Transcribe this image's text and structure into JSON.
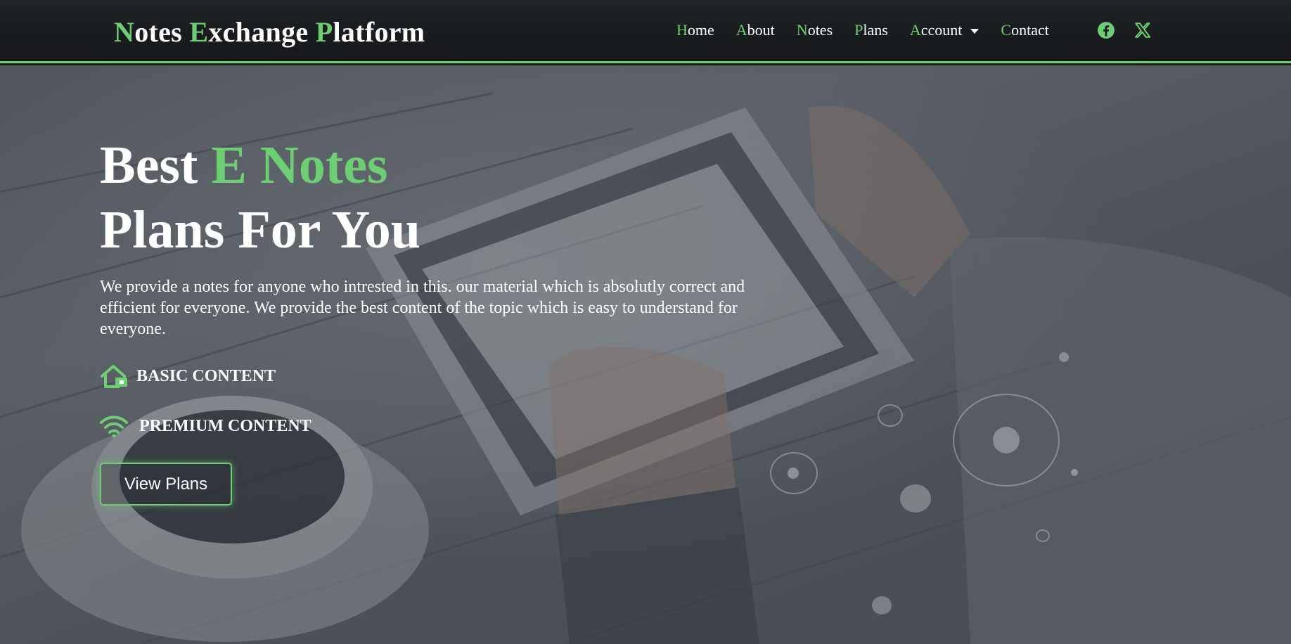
{
  "brand": {
    "words": [
      {
        "first": "N",
        "rest": "otes"
      },
      {
        "first": "E",
        "rest": "xchange"
      },
      {
        "first": "P",
        "rest": "latform"
      }
    ]
  },
  "nav": {
    "items": [
      {
        "first": "H",
        "rest": "ome"
      },
      {
        "first": "A",
        "rest": "bout"
      },
      {
        "first": "N",
        "rest": "otes"
      },
      {
        "first": "P",
        "rest": "lans"
      },
      {
        "first": "A",
        "rest": "ccount"
      },
      {
        "first": "C",
        "rest": "ontact"
      }
    ],
    "social_icons": [
      "facebook-icon",
      "x-twitter-icon"
    ]
  },
  "hero": {
    "title_line1_plain": "Best ",
    "title_line1_accent": "E Notes",
    "title_line2": "Plans For You",
    "description": "We provide a notes for anyone who intrested in this. our material which is absolutly correct and efficient for everyone. We provide the best content of the topic which is easy to understand for everyone.",
    "features": [
      {
        "icon": "house-icon",
        "label": "BASIC CONTENT"
      },
      {
        "icon": "wifi-icon",
        "label": "PREMIUM CONTENT"
      }
    ],
    "cta_label": "View Plans"
  },
  "colors": {
    "accent": "#6ccf73",
    "navbar_bg": "#17191b",
    "text": "#ffffff"
  }
}
